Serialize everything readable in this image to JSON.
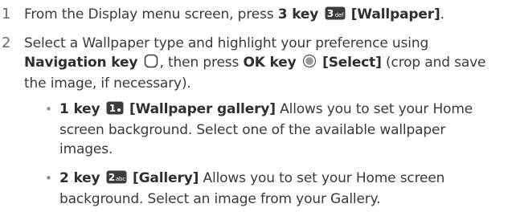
{
  "steps": [
    {
      "number": "1",
      "text_before": "From the Display menu screen, press ",
      "key_label": "3 key",
      "key_icon_glyph": "3",
      "key_icon_sub": "def",
      "bracket_label": "[Wallpaper]",
      "text_after": "."
    },
    {
      "number": "2",
      "line1": "Select a Wallpaper type and highlight your preference using",
      "nav_key_label": "Navigation key",
      "mid_text": ", then press ",
      "ok_key_label": "OK key",
      "ok_bracket_label": "[Select]",
      "tail_text_1": " (crop and save",
      "tail_text_2": "the image, if necessary)."
    }
  ],
  "bullets": [
    {
      "key_label": "1 key",
      "key_icon_glyph": "1",
      "bracket_label": "[Wallpaper gallery]",
      "line1_tail": " Allows you to set your Home",
      "line2": "screen background. Select one of the available wallpaper",
      "line3": "images."
    },
    {
      "key_label": "2 key",
      "key_icon_glyph": "2",
      "key_icon_sub": "abc",
      "bracket_label": "[Gallery]",
      "line1_tail": " Allows you to set your Home screen",
      "line2": "background. Select an image from your Gallery."
    }
  ],
  "bullet_char": "•",
  "icons": {
    "key_icon": "keypad-key-icon",
    "navigation_icon": "navigation-key-icon",
    "ok_icon": "ok-key-icon"
  },
  "colors": {
    "text": "#3a3a3a",
    "bold_text": "#2f2f2f",
    "step_number": "#6d6d6d",
    "key_icon_bg": "#3c3c3c"
  }
}
